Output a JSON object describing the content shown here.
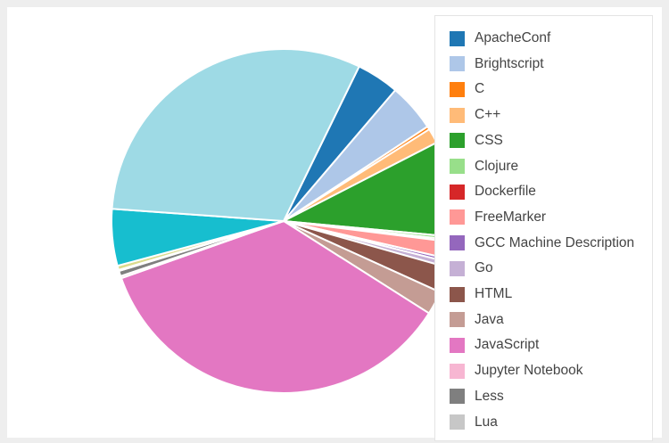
{
  "chart_data": {
    "type": "pie",
    "title": "",
    "series": [
      {
        "name": "ApacheConf",
        "value": 4.0,
        "color": "#1f77b4"
      },
      {
        "name": "Brightscript",
        "value": 4.5,
        "color": "#aec7e8"
      },
      {
        "name": "C",
        "value": 0.3,
        "color": "#ff7f0e"
      },
      {
        "name": "C++",
        "value": 1.4,
        "color": "#ffbb78"
      },
      {
        "name": "CSS",
        "value": 9.0,
        "color": "#2ca02c"
      },
      {
        "name": "Clojure",
        "value": 0.3,
        "color": "#98df8a"
      },
      {
        "name": "Dockerfile",
        "value": 0.2,
        "color": "#d62728"
      },
      {
        "name": "FreeMarker",
        "value": 1.6,
        "color": "#ff9896"
      },
      {
        "name": "GCC Machine Description",
        "value": 0.3,
        "color": "#9467bd"
      },
      {
        "name": "Go",
        "value": 0.5,
        "color": "#c5b0d5"
      },
      {
        "name": "HTML",
        "value": 2.4,
        "color": "#8c564b"
      },
      {
        "name": "Java",
        "value": 2.2,
        "color": "#c49c94"
      },
      {
        "name": "JavaScript",
        "value": 35.5,
        "color": "#e377c2"
      },
      {
        "name": "Jupyter Notebook",
        "value": 0.2,
        "color": "#f7b6d2"
      },
      {
        "name": "Less",
        "value": 0.5,
        "color": "#7f7f7f"
      },
      {
        "name": "Lua",
        "value": 0.1,
        "color": "#c7c7c7"
      },
      {
        "name": "",
        "value": 0.4,
        "color": "#dbdb8d"
      },
      {
        "name": "",
        "value": 5.3,
        "color": "#17becf"
      },
      {
        "name": "",
        "value": 31.0,
        "color": "#9edae5"
      }
    ],
    "legend_position": "right"
  }
}
